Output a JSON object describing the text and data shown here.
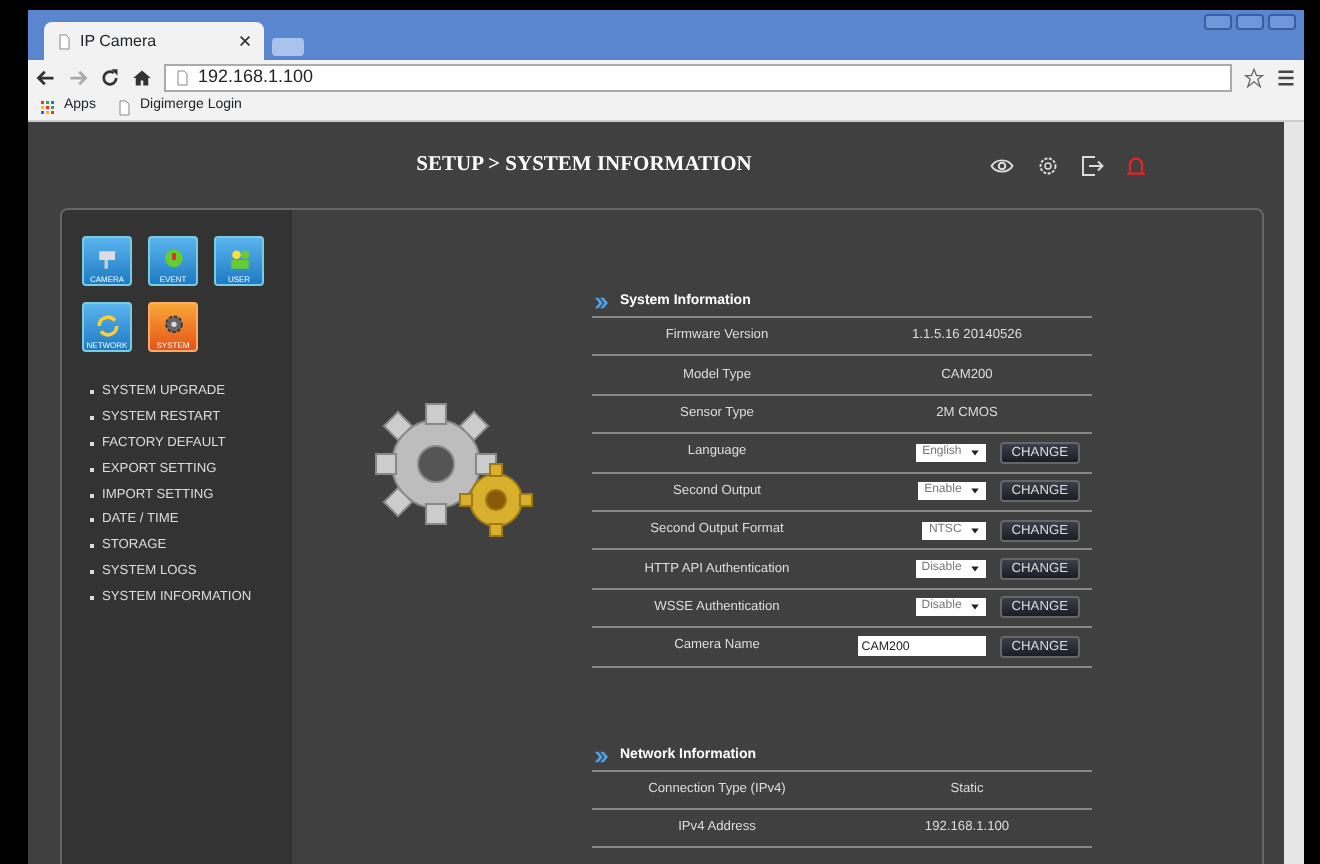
{
  "browser": {
    "tab_title": "IP Camera",
    "url": "192.168.1.100",
    "bookmarks": [
      "Apps",
      "Digimerge Login"
    ]
  },
  "header": {
    "title": "SETUP > SYSTEM INFORMATION"
  },
  "category_tiles": [
    {
      "label": "CAMERA",
      "selected": false
    },
    {
      "label": "EVENT",
      "selected": false
    },
    {
      "label": "USER",
      "selected": false
    },
    {
      "label": "NETWORK",
      "selected": false
    },
    {
      "label": "SYSTEM",
      "selected": true
    }
  ],
  "menu": [
    "SYSTEM UPGRADE",
    "SYSTEM RESTART",
    "FACTORY DEFAULT",
    "EXPORT SETTING",
    "IMPORT SETTING",
    "DATE / TIME",
    "STORAGE",
    "SYSTEM LOGS",
    "SYSTEM INFORMATION"
  ],
  "sections": [
    {
      "title": "System Information",
      "rows": [
        {
          "kind": "text",
          "label": "Firmware Version",
          "value": "1.1.5.16 20140526"
        },
        {
          "kind": "text",
          "label": "Model Type",
          "value": "CAM200"
        },
        {
          "kind": "text",
          "label": "Sensor Type",
          "value": "2M CMOS"
        },
        {
          "kind": "select",
          "label": "Language",
          "value": "English",
          "button": "CHANGE"
        },
        {
          "kind": "select",
          "label": "Second Output",
          "value": "Enable",
          "button": "CHANGE"
        },
        {
          "kind": "select",
          "label": "Second Output Format",
          "value": "NTSC",
          "button": "CHANGE"
        },
        {
          "kind": "select",
          "label": "HTTP API Authentication",
          "value": "Disable",
          "button": "CHANGE"
        },
        {
          "kind": "select",
          "label": "WSSE Authentication",
          "value": "Disable",
          "button": "CHANGE"
        },
        {
          "kind": "input",
          "label": "Camera Name",
          "value": "CAM200",
          "button": "CHANGE"
        }
      ]
    },
    {
      "title": "Network Information",
      "rows": [
        {
          "kind": "text",
          "label": "Connection Type (IPv4)",
          "value": "Static"
        },
        {
          "kind": "text",
          "label": "IPv4 Address",
          "value": "192.168.1.100"
        }
      ]
    }
  ]
}
